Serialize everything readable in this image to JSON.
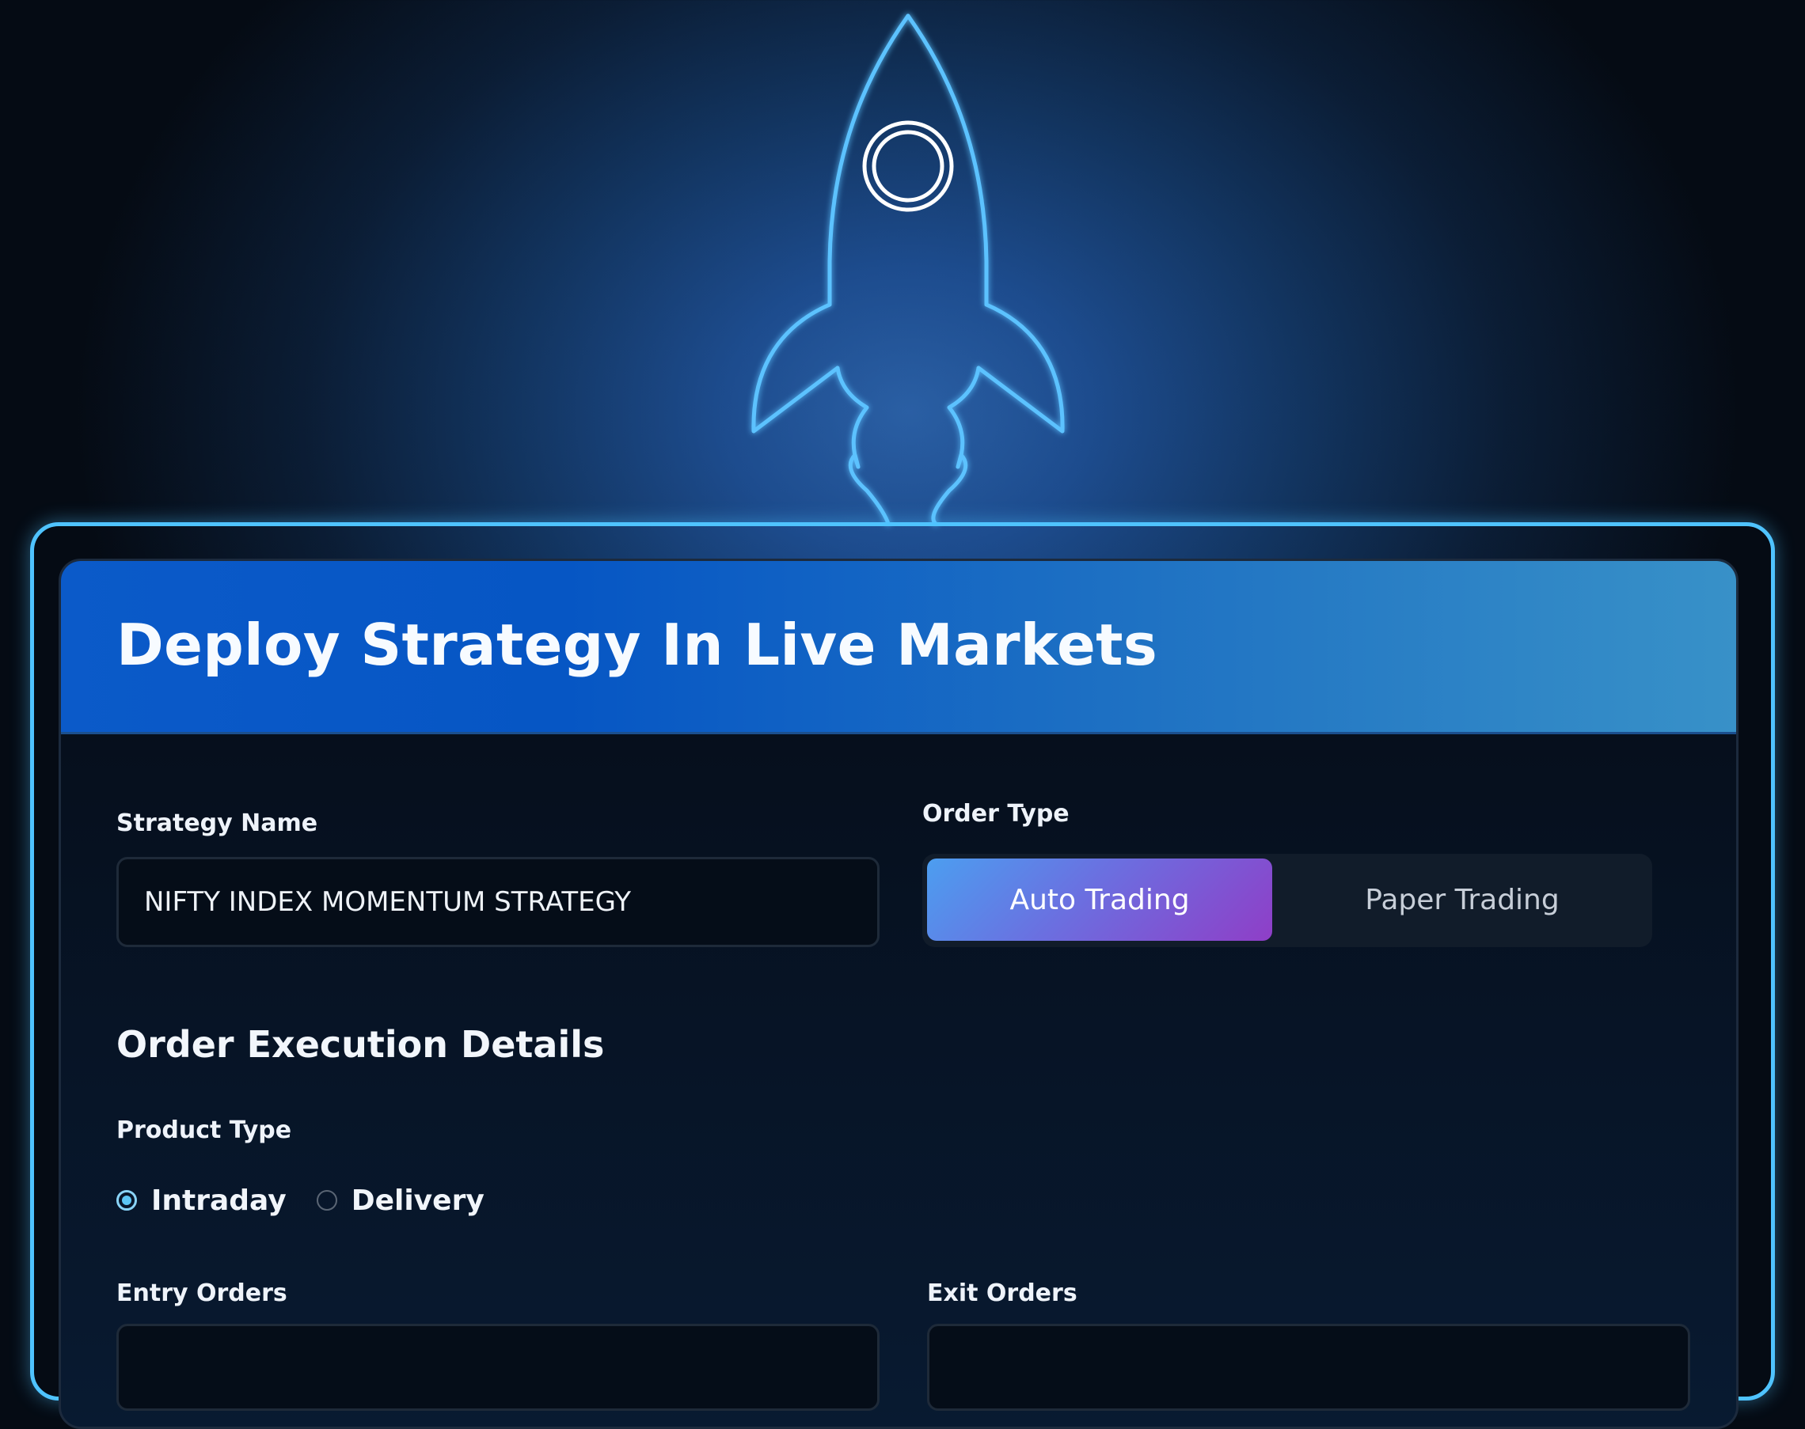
{
  "header": {
    "title": "Deploy Strategy In Live Markets"
  },
  "strategy": {
    "label": "Strategy Name",
    "value": "NIFTY INDEX MOMENTUM STRATEGY"
  },
  "order_type": {
    "label": "Order Type",
    "options": [
      "Auto Trading",
      "Paper Trading"
    ],
    "selected": "Auto Trading"
  },
  "execution": {
    "heading": "Order Execution Details",
    "product_type": {
      "label": "Product Type",
      "options": [
        "Intraday",
        "Delivery"
      ],
      "selected": "Intraday"
    },
    "entry_orders_label": "Entry Orders",
    "exit_orders_label": "Exit Orders"
  },
  "colors": {
    "accent_cyan": "#4fc3ff",
    "header_blue": "#0656c4",
    "toggle_start": "#4c9ef0",
    "toggle_end": "#8f3ec7"
  },
  "icons": {
    "rocket": "rocket-icon"
  }
}
